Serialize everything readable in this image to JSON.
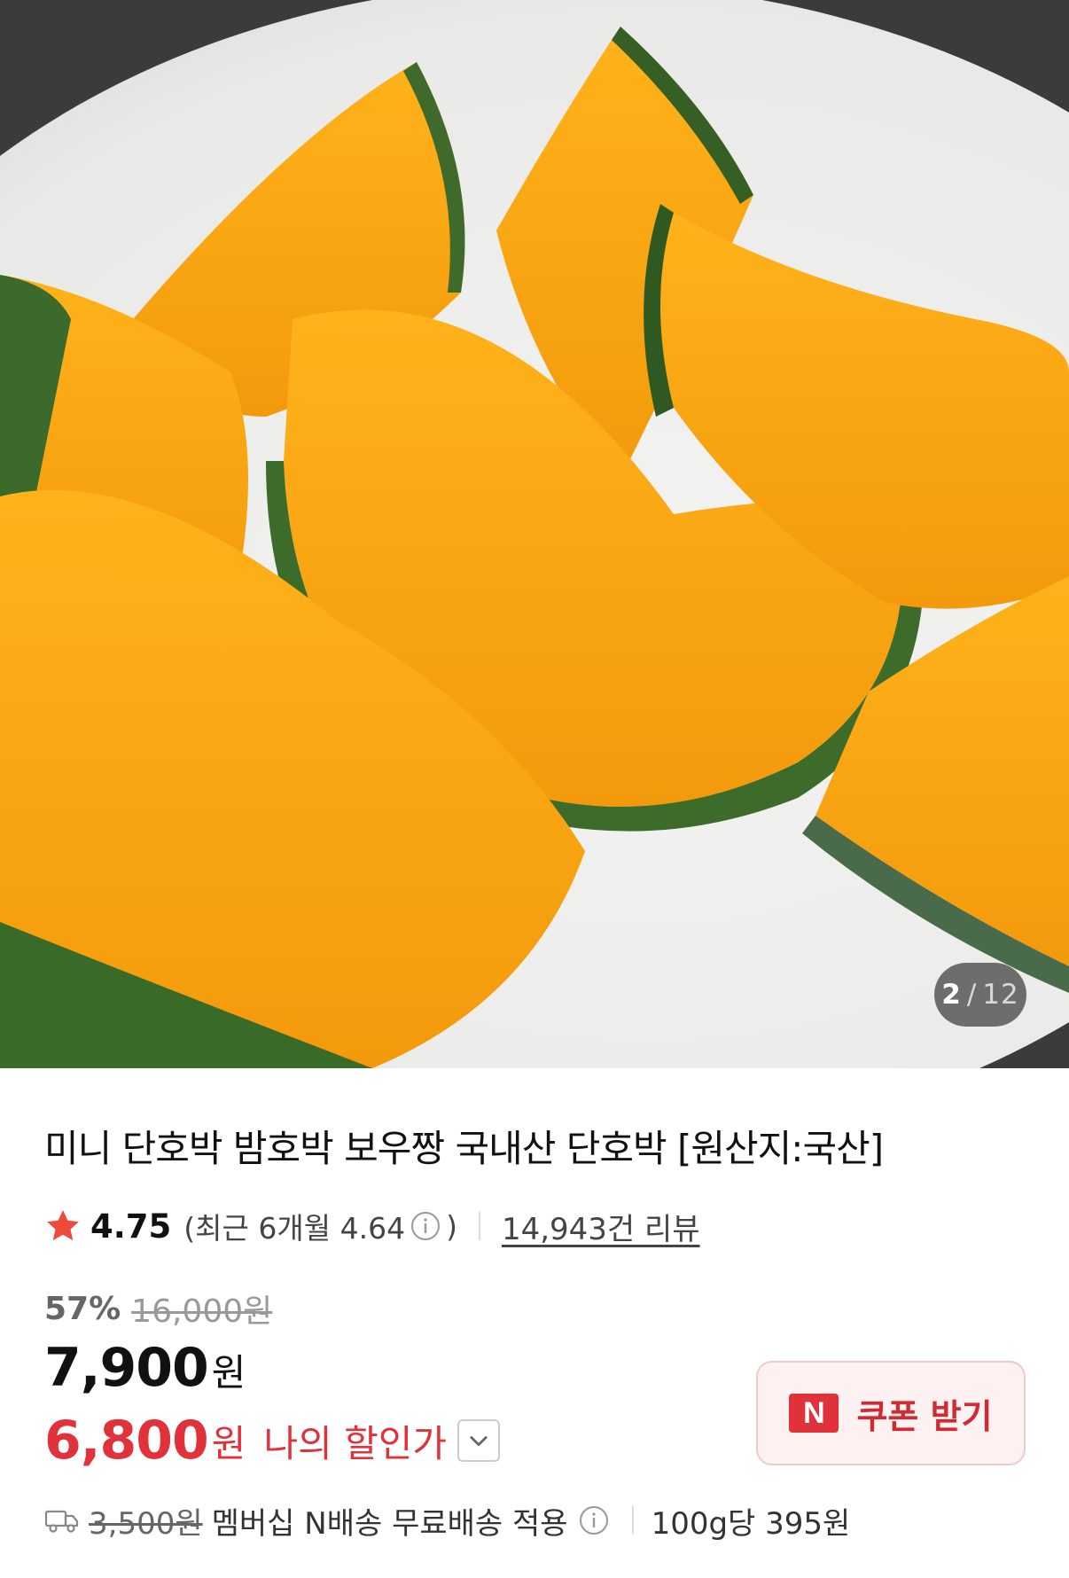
{
  "gallery": {
    "current": "2",
    "separator": "/",
    "total": "12"
  },
  "product": {
    "title": "미니 단호박 밤호박 보우짱 국내산 단호박 [원산지:국산]"
  },
  "rating": {
    "score": "4.75",
    "recent_prefix": "(최근 6개월 4.64",
    "recent_suffix": ")",
    "reviews": "14,943건 리뷰",
    "star_color": "#f04a3c"
  },
  "pricing": {
    "discount_rate": "57%",
    "original_price": "16,000원",
    "price": "7,900",
    "won": "원",
    "my_price": "6,800",
    "my_won": "원",
    "my_label": "나의 할인가",
    "accent_color": "#e0323a"
  },
  "coupon": {
    "badge": "N",
    "label": "쿠폰 받기"
  },
  "shipping": {
    "original_fee": "3,500원",
    "text": "멤버십 N배송 무료배송 적용",
    "unit_price": "100g당 395원"
  },
  "icons": [
    "star-icon",
    "info-icon",
    "chevron-down-icon",
    "truck-icon",
    "naver-n-icon"
  ]
}
